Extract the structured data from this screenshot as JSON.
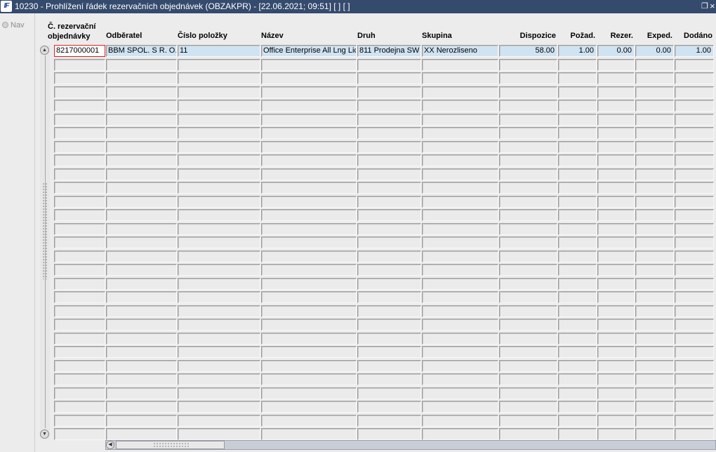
{
  "window": {
    "title": "10230 - Prohlížení řádek rezervačních objednávek (OBZAKPR) - [22.06.2021; 09:51]  [ ]  [ ]",
    "logo_text": "IF"
  },
  "sidebar": {
    "nav_label": "Nav"
  },
  "grid": {
    "columns": [
      {
        "key": "order_no",
        "header": "Č. rezervační\nobjednávky",
        "align": "left"
      },
      {
        "key": "customer",
        "header": "Odběratel",
        "align": "left"
      },
      {
        "key": "item_no",
        "header": "Číslo položky",
        "align": "left"
      },
      {
        "key": "name",
        "header": "Název",
        "align": "left"
      },
      {
        "key": "kind",
        "header": "Druh",
        "align": "left"
      },
      {
        "key": "group",
        "header": "Skupina",
        "align": "left"
      },
      {
        "key": "available",
        "header": "Dispozice",
        "align": "right"
      },
      {
        "key": "requested",
        "header": "Požad.",
        "align": "right"
      },
      {
        "key": "reserved",
        "header": "Rezer.",
        "align": "right"
      },
      {
        "key": "dispatched",
        "header": "Exped.",
        "align": "right"
      },
      {
        "key": "delivered",
        "header": "Dodáno",
        "align": "right"
      }
    ],
    "visible_rows": 29,
    "rows": [
      [
        "8217000001",
        "BBM SPOL. S R. O.",
        "11",
        "Office Enterprise All Lng Lic",
        "811 Prodejna SW",
        "XX Nerozliseno",
        "58.00",
        "1.00",
        "0.00",
        "0.00",
        "1.00"
      ]
    ]
  },
  "icons": {
    "restore": "restore-window-icon",
    "close": "close-window-icon",
    "scroll_up": "arrow-up-icon",
    "scroll_down": "arrow-down-icon",
    "scroll_left": "arrow-left-icon"
  }
}
